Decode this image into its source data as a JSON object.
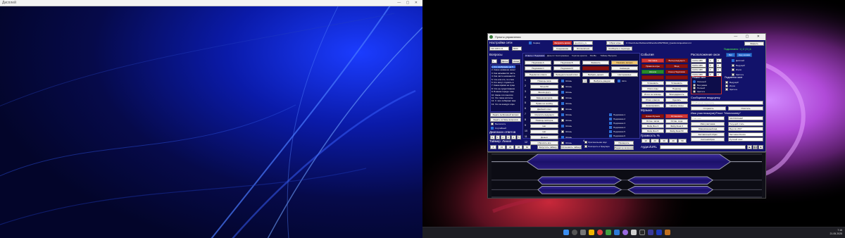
{
  "left_window": {
    "title": "Дисплей"
  },
  "control_panel": {
    "title": "Пульты управления",
    "top": {
      "cb_label": "Сервер",
      "btn_find": "Загрузить архив",
      "file_input": "questions_ru",
      "btn_reset": "Сброс игры",
      "path": "C:\\Users\\User\\Software\\WhereNo\\WWTBAM_Questions\\questions.txt",
      "btn_close": "Закрыть",
      "status": "Подключено: 1 | 2 | 0 | 4",
      "btn_connect": "Соединение",
      "btn_disconnect": "Отключиться",
      "btn_lang": "Сообщить о переходе"
    },
    "network": {
      "title": "Настройки сети",
      "ip": "192.168.0.21",
      "port": "8000"
    },
    "questions": {
      "title": "Вопросы",
      "count": "1",
      "next": "Далее",
      "prev": "Назад",
      "items": [
        "1. Кто изображён на 5",
        "2. Какое название имеет",
        "3. Как называется часть",
        "4. Как часто начинается",
        "5. Что или кто, по слов",
        "6. Кто могут служить в",
        "7. Какое время не суще",
        "8. Что не существовало",
        "9. В каком городе тоже",
        "10. Какие эти понятия",
        "11. Что такое котлеты",
        "12. С чего собирают мак",
        "13. Что за конкурс опре"
      ],
      "btn_ask": "Задать выбранный вопрос",
      "btn_rand": "Задать из базы вопросов",
      "cb_show": "Выполнить",
      "cb_random": "Случайный",
      "range_label": "Диапазон ответов",
      "range_vals": [
        "0",
        "1",
        "2",
        "3",
        "4",
        "5"
      ]
    },
    "timer": {
      "title": "Таймер: Линия",
      "count": "4",
      "vals": [
        "15",
        "30",
        "45",
        "60"
      ],
      "btn_start": "Запустить таймер",
      "btn_stop": "Остановить таймер",
      "cb1": "Оригинальная звук",
      "cb2": "Повторить в браузере",
      "btn_check": "Проверить",
      "btn_editor": "Редактор вопросов"
    },
    "tabs": [
      "Ответы / Подсказки",
      "Деньги / Несгораемые",
      "Горячие кресла",
      "Shuffle",
      "Таймер Выпуска"
    ],
    "answers": {
      "row1": [
        "Подсказка А",
        "Подсказка Б",
        "Заменить",
        "Показать вопрос"
      ],
      "row2": [
        "Подсказка С",
        "Подсказка D",
        "Показать",
        "Анимация"
      ],
      "row3": [
        "Подсветка ответа",
        "Принудительный ответ",
        "Выбрать деньги",
        "Несгораемые"
      ],
      "input_val": "12",
      "btn_rand": "Выбрать рандом",
      "cb_auto": "Авто",
      "list": [
        "Помощь зала",
        "50 на 50",
        "Звонок другу",
        "Замена вопроса",
        "Право на ошибку",
        "Двойной ответ",
        "Спросить ведущего",
        "Помощь эксперта",
        "Нет",
        "Нет",
        "Деньги",
        "Сбросить все"
      ],
      "nums": [
        "1",
        "2",
        "3",
        "4",
        "5",
        "6",
        "7",
        "8",
        "9",
        "10",
        "11",
        "12"
      ],
      "check_labels": [
        "Жизнь",
        "Жизнь",
        "Жизнь",
        "Жизнь",
        "Жизнь",
        "Жизнь",
        "Жизнь",
        "Жизнь",
        "Жизнь",
        "Жизнь",
        "Жизнь",
        "Жизнь"
      ],
      "right_cbs": [
        "Подсказка 1",
        "Подсказка 2",
        "Подсказка 3",
        "Подсказка 4",
        "Подсказка 5",
        "Подсказка 6"
      ]
    },
    "events": {
      "title": "События",
      "btns": [
        [
          "Заставка",
          "Выход ведущего"
        ],
        [
          "Правила игры",
          "Вход"
        ],
        [
          "Начало",
          "Конец Подсказок"
        ],
        [
          "",
          ""
        ],
        [
          "Установить",
          "Установить"
        ],
        [
          "Итоги игры",
          "Переход"
        ],
        [
          "Итоги за помощь",
          "Благодарность"
        ],
        [
          "Итоги ответов",
          "Сделать"
        ],
        [
          "Анонсировать",
          "Начать титры"
        ]
      ]
    },
    "music": {
      "title": "Музыка",
      "btns": [
        [
          "Новая Музыка",
          "Остановить"
        ],
        [
          "Остан. часов",
          "Остан. хода"
        ],
        [
          "Фейд Фон 3",
          "Фейд Зона 3"
        ],
        [
          "Фейд Фон 5",
          "Фейд Зона 50"
        ]
      ]
    },
    "volume": {
      "title": "Громкость %",
      "vals": [
        "10",
        "20",
        "30",
        "40",
        "50"
      ]
    },
    "audio": {
      "title": "Аудио/URL"
    },
    "layout": {
      "title": "Расположение окон",
      "btn_on": "Вкл",
      "btn_top": "Над окнами",
      "rows": [
        {
          "res": "1920x1080",
          "n": "0",
          "m": "0",
          "label": "Дисплей"
        },
        {
          "res": "1920x1080",
          "n": "0",
          "m": "0",
          "label": "Ведущий"
        },
        {
          "res": "1920x1080",
          "n": "0",
          "m": "0",
          "label": "Игрок"
        },
        {
          "res": "1920x1080",
          "n": "0",
          "m": "0",
          "label": "Зритель"
        }
      ]
    },
    "window_mode": {
      "title": "Режим окон",
      "opts": [
        "Оконный",
        "Без рамки",
        "Полный",
        "Зритель"
      ]
    },
    "highlight": {
      "title": "Подсветка окон",
      "opts": [
        "Ведущий",
        "Игрок",
        "Зритель"
      ]
    },
    "message": {
      "title": "Сообщение ведущему",
      "placeholder": "Сообщение ведущему",
      "btn_send": "Отправить",
      "btn_clear": "Очистить"
    },
    "names": {
      "title": "Имя участника(ов)/Текст \"Миллионер\"",
      "rows": [
        [
          "Участник",
          "МИЛЛИОНЕР"
        ],
        [
          "Имя участника",
          "Текущий стиль"
        ],
        [
          "Оформленный вид",
          "Версия 2007"
        ],
        [
          "Заставочный образ",
          "Заставка Russia"
        ],
        [
          "Костюм/образ",
          "Русский язык"
        ]
      ]
    }
  },
  "taskbar": {
    "time": "7:16",
    "date": "21.05.2025"
  }
}
